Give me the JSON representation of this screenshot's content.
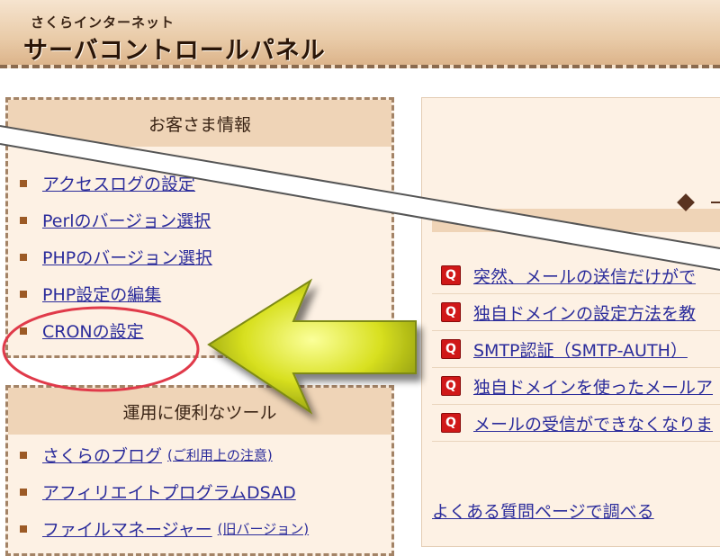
{
  "header": {
    "subtitle": "さくらインターネット",
    "title": "サーバコントロールパネル"
  },
  "customer_panel": {
    "heading": "お客さま情報",
    "items": [
      {
        "label": "アクセスログの設定"
      },
      {
        "label": "Perlのバージョン選択"
      },
      {
        "label": "PHPのバージョン選択"
      },
      {
        "label": "PHP設定の編集"
      },
      {
        "label": "CRONの設定"
      }
    ]
  },
  "useful_panel": {
    "heading": "運用に便利なツール",
    "items": [
      {
        "label": "さくらのブログ",
        "note": "(ご利用上の注意)"
      },
      {
        "label": "アフィリエイトプログラムDSAD"
      },
      {
        "label": "ファイルマネージャー",
        "note": "(旧バージョン)"
      }
    ]
  },
  "faq": {
    "icon_text": "Q",
    "items": [
      {
        "label": "突然、メールの送信だけがで"
      },
      {
        "label": "独自ドメインの設定方法を教"
      },
      {
        "label": "SMTP認証（SMTP-AUTH）"
      },
      {
        "label": "独自ドメインを使ったメールア"
      },
      {
        "label": "メールの受信ができなくなりま"
      }
    ],
    "more_link": "よくある質問ページで調べる"
  },
  "annotation": {
    "circle_color": "#e03a4a",
    "arrow_color": "#d8e020"
  }
}
